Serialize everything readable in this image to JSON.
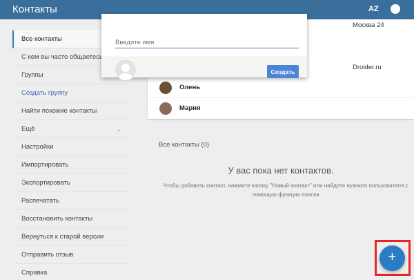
{
  "header": {
    "title": "Контакты",
    "sort_label": "AZ"
  },
  "sidebar": {
    "items": [
      {
        "label": "Все контакты"
      },
      {
        "label": "С кем вы часто общаетесь"
      },
      {
        "label": "Группы"
      },
      {
        "label": "Создать группу"
      },
      {
        "label": "Найти похожие контакты"
      },
      {
        "label": "Ещё"
      },
      {
        "label": "Настройки"
      },
      {
        "label": "Импортировать"
      },
      {
        "label": "Экспортировать"
      },
      {
        "label": "Распечатать"
      },
      {
        "label": "Восстановить контакты"
      },
      {
        "label": "Вернуться к старой версии"
      },
      {
        "label": "Отправить отзыв"
      },
      {
        "label": "Справка"
      }
    ]
  },
  "contacts": {
    "org_top": "Москва 24",
    "org_mid": "Droider.ru",
    "rows": [
      {
        "name": "Олень"
      },
      {
        "name": "Мария"
      }
    ]
  },
  "empty": {
    "section_title": "Все контакты (0)",
    "headline": "У вас пока нет контактов.",
    "hint": "Чтобы добавить контакт, нажмите кнопку \"Новый контакт\" или найдите нужного пользователя с помощью функции поиска"
  },
  "dialog": {
    "name_placeholder": "Введите имя",
    "create_label": "Создать"
  },
  "fab": {
    "label": "+"
  },
  "colors": {
    "header": "#3a6f9b",
    "accent": "#4a86d6",
    "fab": "#2a7dc4",
    "highlight": "#e8242b"
  }
}
